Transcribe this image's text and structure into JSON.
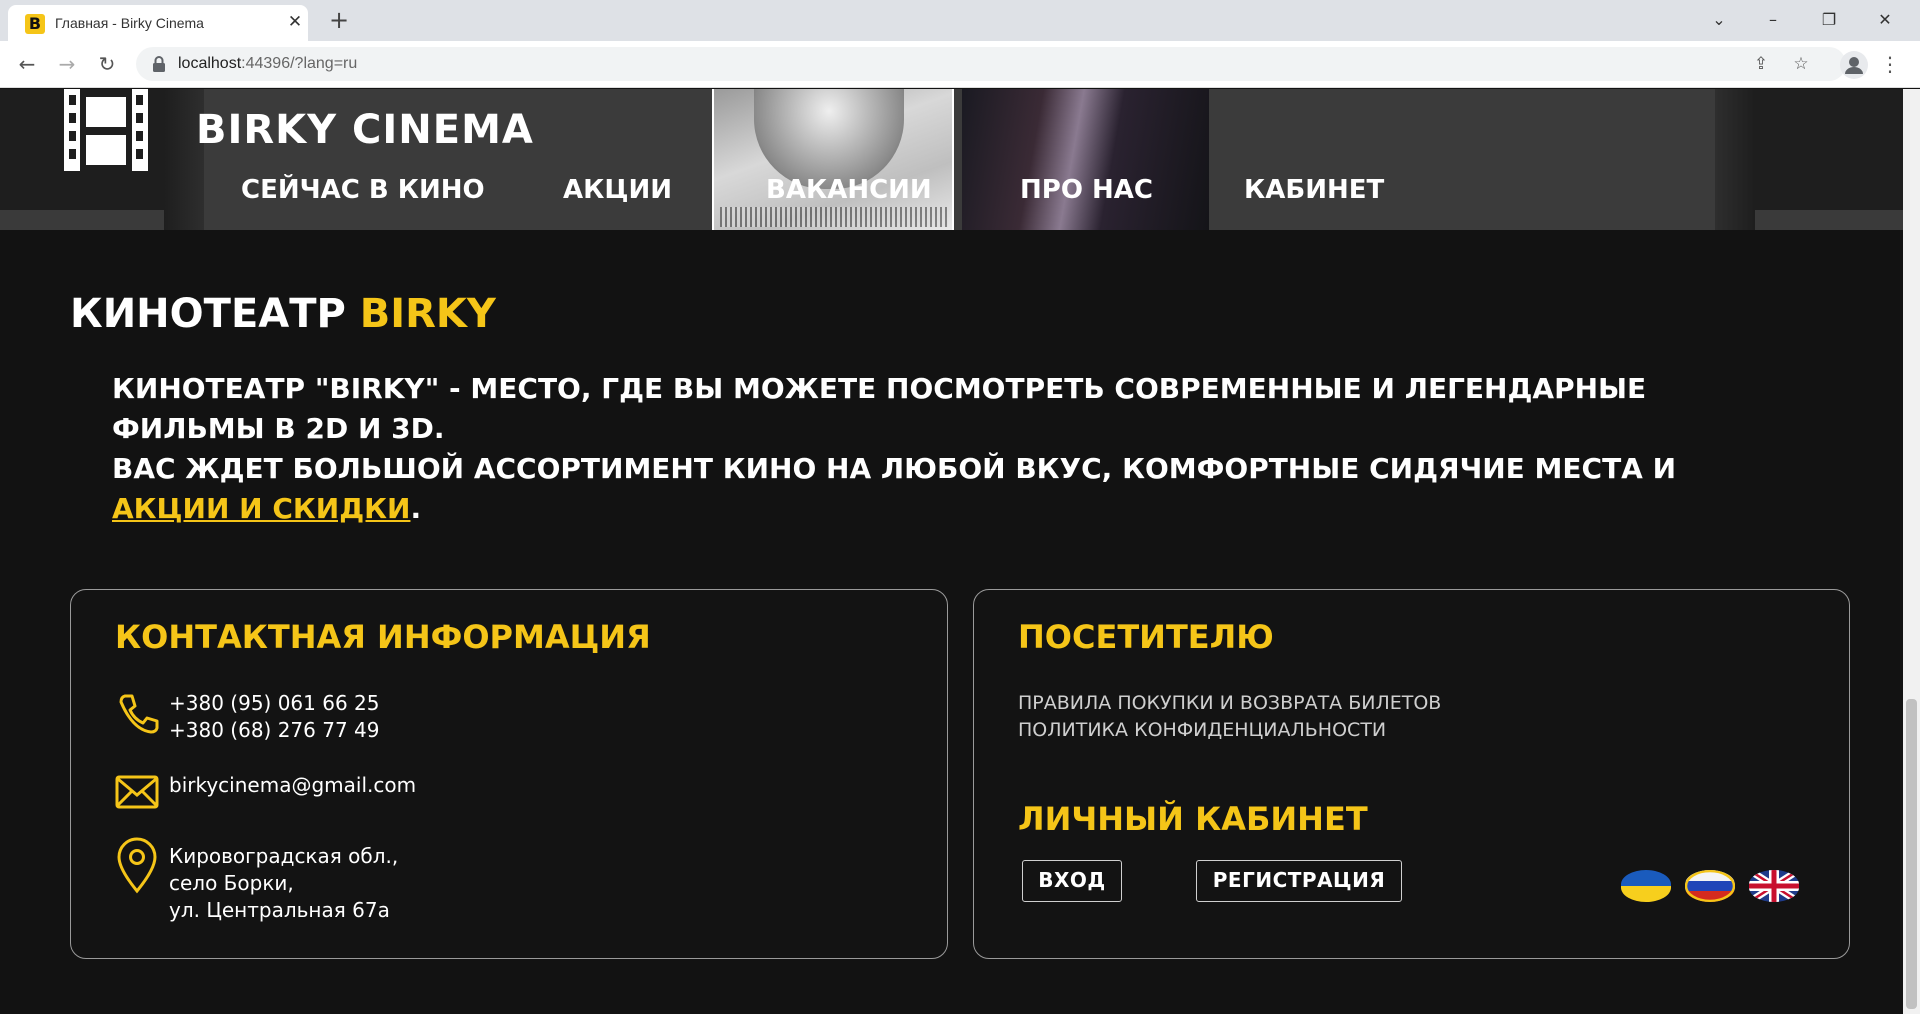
{
  "browser": {
    "tab_title": "Главная - Birky Cinema",
    "favicon_letter": "B",
    "url_host": "localhost",
    "url_rest": ":44396/?lang=ru"
  },
  "site": {
    "brand": "BIRKY CINEMA",
    "nav": [
      "СЕЙЧАС В КИНО",
      "АКЦИИ",
      "ВАКАНСИИ",
      "ПРО НАС",
      "КАБИНЕТ"
    ]
  },
  "intro": {
    "title_main": "КИНОТЕАТР ",
    "title_accent": "BIRKY",
    "line1": "КИНОТЕАТР \"BIRKY\" - МЕСТО, ГДЕ ВЫ МОЖЕТЕ ПОСМОТРЕТЬ СОВРЕМЕННЫЕ И ЛЕГЕНДАРНЫЕ ФИЛЬМЫ В 2D И 3D.",
    "line2_start": "ВАС ЖДЕТ БОЛЬШОЙ АССОРТИМЕНТ КИНО НА ЛЮБОЙ ВКУС, КОМФОРТНЫЕ СИДЯЧИЕ МЕСТА И ",
    "line2_link": "АКЦИИ И СКИДКИ",
    "line2_end": "."
  },
  "contacts": {
    "title": "КОНТАКТНАЯ ИНФОРМАЦИЯ",
    "phone1": "+380 (95) 061 66 25",
    "phone2": "+380 (68) 276 77 49",
    "email": "birkycinema@gmail.com",
    "address1": "Кировоградская обл.,",
    "address2": "село Борки,",
    "address3": "ул. Центральная 67а"
  },
  "visitor": {
    "title": "ПОСЕТИТЕЛЮ",
    "link1": "ПРАВИЛА ПОКУПКИ И ВОЗВРАТА БИЛЕТОВ",
    "link2": "ПОЛИТИКА КОНФИДЕНЦИАЛЬНОСТИ",
    "cabinet_title": "ЛИЧНЫЙ КАБИНЕТ",
    "login": "ВХОД",
    "register": "РЕГИСТРАЦИЯ"
  },
  "colors": {
    "accent": "#f5c518",
    "background": "#121212",
    "header": "#1e1e1e"
  }
}
